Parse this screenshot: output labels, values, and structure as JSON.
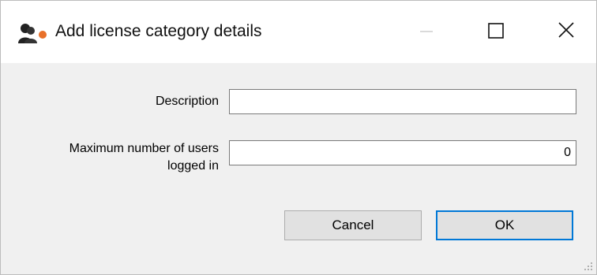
{
  "window": {
    "title": "Add license category details"
  },
  "icons": {
    "app": "users-icon",
    "minimize": "minimize-icon",
    "maximize": "maximize-icon",
    "close": "close-icon"
  },
  "form": {
    "description_label": "Description",
    "description_value": "",
    "max_users_label_line1": "Maximum number of users",
    "max_users_label_line2": "logged in",
    "max_users_value": "0"
  },
  "buttons": {
    "cancel": "Cancel",
    "ok": "OK"
  },
  "colors": {
    "accent": "#0078d7",
    "app_icon_orange": "#e8702a"
  }
}
